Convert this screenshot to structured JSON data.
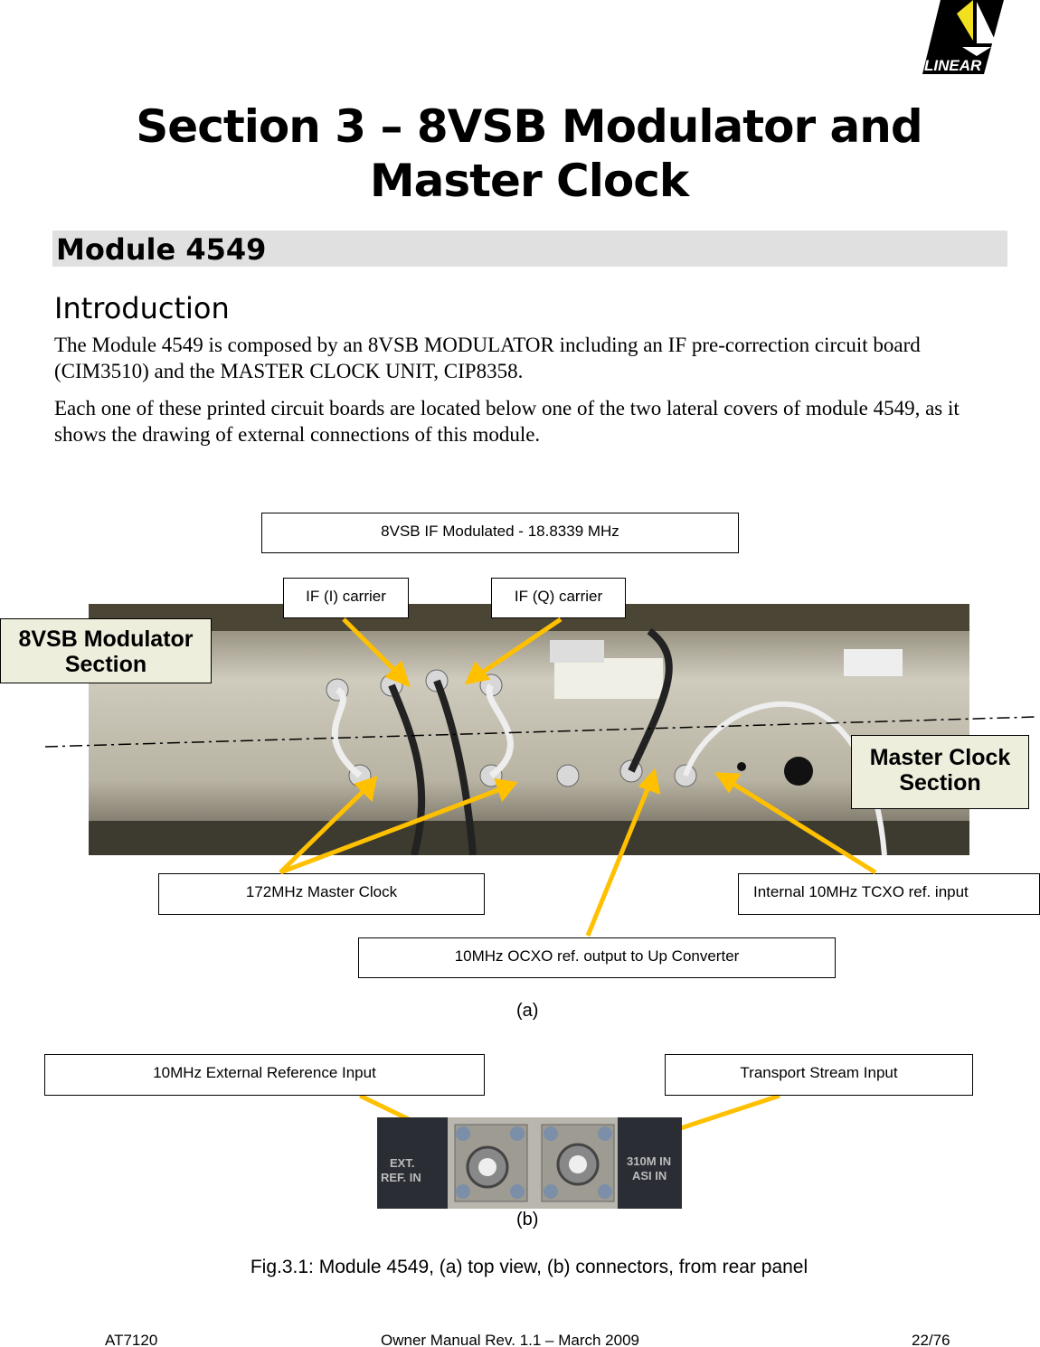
{
  "logo": {
    "text": "LINEAR"
  },
  "title": "Section 3 – 8VSB Modulator and Master Clock",
  "module_heading": "Module 4549",
  "intro_heading": "Introduction",
  "paragraphs": [
    "The Module 4549 is composed by an 8VSB MODULATOR including an IF pre-correction circuit board (CIM3510) and the MASTER CLOCK UNIT, CIP8358.",
    "Each one of these printed circuit boards are located below one of the two lateral covers of module 4549, as it shows the drawing of external connections of this module."
  ],
  "figure_a": {
    "labels": {
      "if_modulated": "8VSB IF Modulated - 18.8339 MHz",
      "if_i": "IF (I) carrier",
      "if_q": "IF (Q) carrier",
      "modulator_section": "8VSB Modulator Section",
      "master_clock_section": "Master Clock Section",
      "master_clock_172": "172MHz Master Clock",
      "tcxo": "Internal 10MHz TCXO ref. input",
      "ocxo": "10MHz OCXO ref. output to Up Converter"
    },
    "caption": "(a)"
  },
  "figure_b": {
    "labels": {
      "ext_ref": "10MHz External Reference Input",
      "ts_input": "Transport Stream Input"
    },
    "panel_text": {
      "left": "EXT. REF. IN",
      "right": "310M IN ASI IN"
    },
    "caption": "(b)"
  },
  "figure_caption": "Fig.3.1: Module 4549, (a) top view, (b) connectors, from rear panel",
  "footer": {
    "left": "AT7120",
    "center": "Owner Manual Rev. 1.1 – March 2009",
    "right": "22/76"
  },
  "colors": {
    "arrow": "#ffc000",
    "section_bg": "#eeeedd",
    "heading_bg": "#e0e0e0"
  }
}
